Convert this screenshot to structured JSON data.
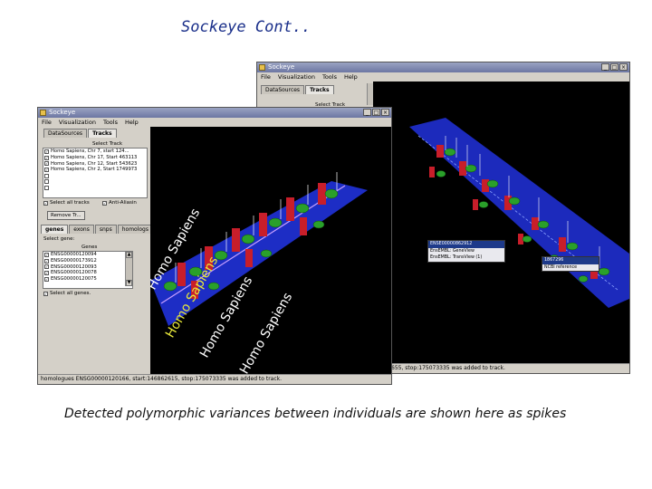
{
  "slide": {
    "title": "Sockeye Cont..",
    "caption": "Detected polymorphic variances between individuals are shown here as spikes"
  },
  "back_window": {
    "title": "Sockeye",
    "menu": [
      "File",
      "Visualization",
      "Tools",
      "Help"
    ],
    "tabs": [
      "DataSources",
      "Tracks"
    ],
    "select_track_label": "Select Track",
    "popup": {
      "items": [
        "ENSE00000862912",
        "EnsEMBL: GeneView",
        "EnsEMBL: TransView (1)"
      ]
    },
    "popup2": {
      "items": [
        "1867296",
        "NCBI reference"
      ]
    },
    "status": "655, stop:175073335 was added to track."
  },
  "front_window": {
    "title": "Sockeye",
    "menu": [
      "File",
      "Visualization",
      "Tools",
      "Help"
    ],
    "tabs": [
      "DataSources",
      "Tracks"
    ],
    "select_track_label": "Select Track",
    "tracks": [
      "Homo Sapiens, Chr 7, start 124...",
      "Homo Sapiens, Chr 17, Start 463113",
      "Homo Sapiens, Chr 12, Start 543623",
      "Homo Sapiens, Chr 2, Start 1749973"
    ],
    "select_all_tracks": "Select all tracks",
    "anti_alias": "Anti-Aliasin",
    "remove_btn": "Remove Tr...",
    "lower_tabs": [
      "genes",
      "exons",
      "snps",
      "homologs"
    ],
    "select_gene_label": "Select gene:",
    "genes_header": "Genes",
    "genes": [
      "ENSG00000120094",
      "ENSG00000173912",
      "ENSG00000120093",
      "ENSG00000120078",
      "ENSG00000120075"
    ],
    "select_all_genes": "Select all genes.",
    "status": "homologues ENSG00000120166, start:146862615, stop:175073335 was added to track.",
    "scene_labels": [
      "Homo Sapiens",
      "Homo Sapiens",
      "Homo Sapiens",
      "Homo Sapiens",
      "Homo Sapiens"
    ]
  },
  "colors": {
    "title_blue": "#1a2f8a",
    "plane_blue": "#1f2fd0",
    "gene_green": "#2aa02a",
    "bar_red": "#c81e2a",
    "label_yellow": "#e8e83a"
  }
}
